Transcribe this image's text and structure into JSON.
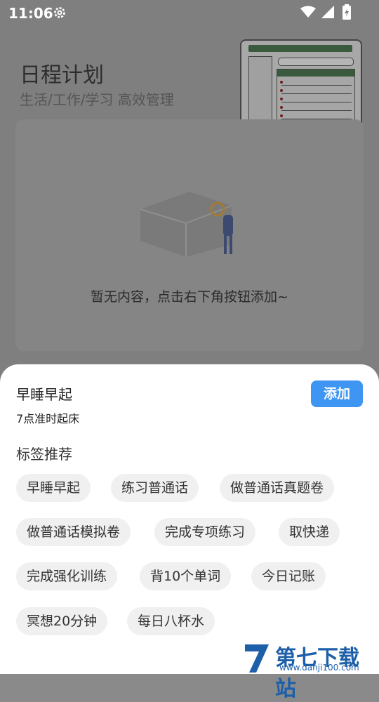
{
  "status_bar": {
    "time": "11:06"
  },
  "header": {
    "title": "日程计划",
    "subtitle": "生活/工作/学习 高效管理"
  },
  "empty_state": {
    "message": "暂无内容，点击右下角按钮添加~"
  },
  "sheet": {
    "task_title": "早睡早起",
    "task_desc": "7点准时起床",
    "add_label": "添加",
    "tags_heading": "标签推荐",
    "tags": [
      "早睡早起",
      "练习普通话",
      "做普通话真题卷",
      "做普通话模拟卷",
      "完成专项练习",
      "取快递",
      "完成强化训练",
      "背10个单词",
      "今日记账",
      "冥想20分钟",
      "每日八杯水"
    ]
  },
  "watermark": {
    "text": "第七下载站",
    "url": "www.danji100.com"
  },
  "colors": {
    "accent": "#3f95f2",
    "dim_overlay": "#7f7f7f",
    "chip_bg": "#f0f0f0"
  }
}
